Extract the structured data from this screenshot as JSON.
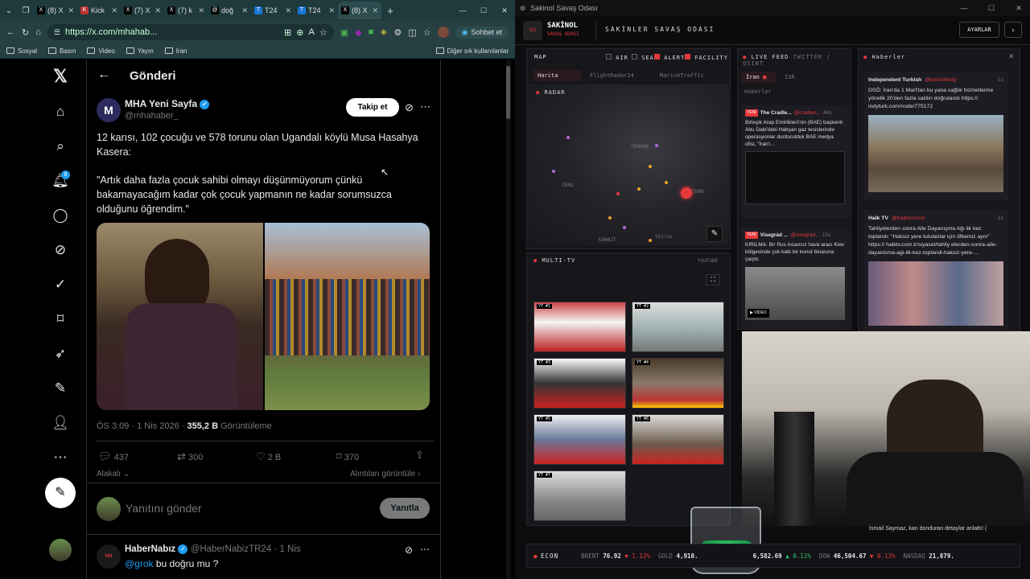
{
  "browser": {
    "tabs": [
      {
        "label": "(8) X",
        "icon": "x-icon",
        "color": "#000"
      },
      {
        "label": "Kick",
        "icon": "kick-icon",
        "color": "#53fc18"
      },
      {
        "label": "(7) X",
        "icon": "x-icon",
        "color": "#000"
      },
      {
        "label": "(7) k",
        "icon": "x-icon",
        "color": "#000"
      },
      {
        "label": "doğ",
        "icon": "threads-icon",
        "color": "#000"
      },
      {
        "label": "T24",
        "icon": "t24-icon",
        "color": "#1976d2"
      },
      {
        "label": "T24",
        "icon": "t24-icon",
        "color": "#1976d2"
      },
      {
        "label": "(8) X",
        "icon": "x-icon",
        "color": "#000"
      }
    ],
    "url": "https://x.com/mhahab...",
    "copilot_label": "Sohbet et",
    "bookmarks": [
      "Sosyal",
      "Basın",
      "Video",
      "Yayın",
      "İran"
    ],
    "other_bookmarks": "Diğer sık kullanılanlar"
  },
  "x": {
    "header_title": "Gönderi",
    "notification_count": "8",
    "post": {
      "author_name": "MHA Yeni Sayfa",
      "author_handle": "@mhahaber_",
      "follow_label": "Takip et",
      "text_line1": "12 karısı, 102 çocuğu ve 578 torunu olan Ugandalı köylü Musa Hasahya",
      "text_line2": "Kasera:",
      "quote_line1": "\"Artık daha fazla çocuk sahibi olmayı düşünmüyorum çünkü",
      "quote_line2": "bakamayacağım kadar çok çocuk yapmanın ne kadar sorumsuzca",
      "quote_line3": "olduğunu öğrendim.\"",
      "time": "ÖS 3:09 · 1 Nis 2026 ·",
      "views": "355,2 B",
      "views_label": "Görüntüleme",
      "replies": "437",
      "reposts": "300",
      "likes": "2 B",
      "bookmarks": "370",
      "relevant_label": "Alakalı",
      "quotes_label": "Alıntıları görüntüle",
      "reply_placeholder": "Yanıtını gönder",
      "reply_button": "Yanıtla"
    },
    "reply": {
      "author_name": "HaberNabız",
      "author_handle": "@HaberNabizTR24",
      "time": "· 1 Nis",
      "mention": "@grok",
      "text": "bu doğru mu ?"
    }
  },
  "dashboard": {
    "window_title": "Sakinol Savaş Odası",
    "brand_top": "SAKİNOL",
    "brand_sub": "SAVAŞ ODASI",
    "brand_title": "SAKİNLER SAVAŞ ODASI",
    "settings_label": "AYARLAR",
    "map": {
      "label": "MAP",
      "filters": [
        "AIR",
        "SEA",
        "ALERT",
        "FACILITY"
      ],
      "tabs": [
        "Harita",
        "FlightRadar24",
        "MarineTraffic"
      ],
      "radar_label": "RADAR",
      "places": [
        "TEHRAN",
        "IRAQ",
        "IRAN",
        "KUWAIT",
        "Shiraz"
      ]
    },
    "live_feed": {
      "label": "LIVE FEED",
      "sub": "TWITTER / OSINT",
      "tabs": [
        "İran",
        "İSR",
        "Haberler"
      ],
      "items": [
        {
          "badge": "YENİ",
          "source": "The Cradle...",
          "handle": "@cradlen...",
          "time": "44s",
          "text": "Birleşik Arap Emirlikleri'nin (BAE) başkenti Abu Dabi'deki Habşan gaz tesislerinde operasyonlar durdurulduk BAE medya ofisi, \"İran'ı..."
        },
        {
          "badge": "YENİ",
          "source": "Visegrád ...",
          "handle": "@visegrad...",
          "time": "15s",
          "text": "KIRILMA: Bir Rus insansız hava aracı Kiev bölgesinde çok katlı bir konut binasına çarptı."
        }
      ],
      "video_label": "VİDEO"
    },
    "news": {
      "label": "Haberler",
      "items": [
        {
          "source": "Independent Turkish",
          "handle": "@turkishindy",
          "time": "1s",
          "text": "DSÖ: İran'da 1 Mart'tan bu yana sağlık hizmetlerine yönelik 20'den fazla saldırı doğrulandı https:// indyturk.com/node/775172"
        },
        {
          "source": "Halk TV",
          "handle": "@halktvcomtr",
          "time": "1s",
          "text": "Tahliyelerden sonra Aile Dayanışma Ağı ilk kez toplandı: \"Haksız yere tutulanlar için öfkemiz aynı\" https:// halktv.com.tr/siyaset/tahliy elerden-sonra-aile-dayanisma-agi-ilk-kez-toplandi-haksiz-yere-..."
        }
      ]
    },
    "multitv": {
      "label": "MULTI-TV",
      "sub": "YOUTUBE",
      "channels": [
        "YT #1",
        "YT #2",
        "YT #3",
        "YT #4",
        "YT #5",
        "YT #6",
        "YT #7"
      ]
    },
    "ticker": {
      "label": "ECON",
      "items": [
        {
          "name": "BRENT",
          "value": "76.92",
          "change": "▼ 1.12%",
          "color": "#e5383b"
        },
        {
          "name": "GOLD",
          "value": "4,910.",
          "change": "",
          "color": "#ddd"
        },
        {
          "name": "",
          "value": "6,582.69",
          "change": "▲ 0.11%",
          "color": "#2ecc71"
        },
        {
          "name": "DOW",
          "value": "46,504.67",
          "change": "▼ 0.13%",
          "color": "#e5383b"
        },
        {
          "name": "NASDAQ",
          "value": "21,879.",
          "change": "",
          "color": "#ddd"
        }
      ]
    },
    "caption": "İsmail Saymaz, kan donduran detaylar anlattı! ("
  }
}
